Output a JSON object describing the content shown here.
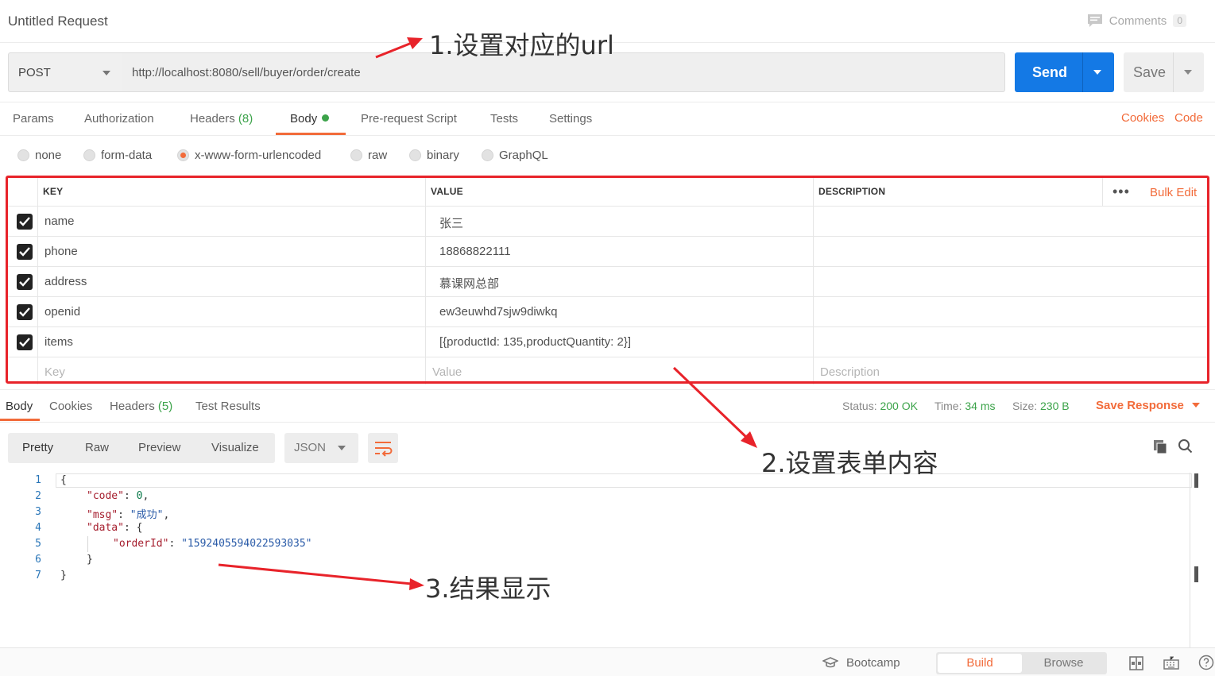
{
  "window": {
    "title": "Untitled Request"
  },
  "comments": {
    "label": "Comments",
    "count": "0"
  },
  "request": {
    "method": "POST",
    "url": "http://localhost:8080/sell/buyer/order/create",
    "send_label": "Send",
    "save_label": "Save"
  },
  "req_tabs": {
    "params": "Params",
    "authorization": "Authorization",
    "headers": "Headers",
    "headers_count": "(8)",
    "body": "Body",
    "prerequest": "Pre-request Script",
    "tests": "Tests",
    "settings": "Settings",
    "cookies": "Cookies",
    "code": "Code"
  },
  "body_types": {
    "none": "none",
    "form_data": "form-data",
    "urlencoded": "x-www-form-urlencoded",
    "raw": "raw",
    "binary": "binary",
    "graphql": "GraphQL",
    "selected": "x-www-form-urlencoded"
  },
  "params_table": {
    "headers": {
      "key": "KEY",
      "value": "VALUE",
      "description": "DESCRIPTION"
    },
    "more": "•••",
    "bulk_edit": "Bulk Edit",
    "rows": [
      {
        "key": "name",
        "value": "张三",
        "description": ""
      },
      {
        "key": "phone",
        "value": "18868822111",
        "description": ""
      },
      {
        "key": "address",
        "value": "慕课网总部",
        "description": ""
      },
      {
        "key": "openid",
        "value": "ew3euwhd7sjw9diwkq",
        "description": ""
      },
      {
        "key": "items",
        "value": "[{productId: 135,productQuantity: 2}]",
        "description": ""
      }
    ],
    "placeholders": {
      "key": "Key",
      "value": "Value",
      "description": "Description"
    }
  },
  "response": {
    "tabs": {
      "body": "Body",
      "cookies": "Cookies",
      "headers": "Headers",
      "headers_count": "(5)",
      "test_results": "Test Results"
    },
    "status_label": "Status:",
    "status_value": "200 OK",
    "time_label": "Time:",
    "time_value": "34 ms",
    "size_label": "Size:",
    "size_value": "230 B",
    "save_response": "Save Response",
    "views": {
      "pretty": "Pretty",
      "raw": "Raw",
      "preview": "Preview",
      "visualize": "Visualize"
    },
    "format": "JSON",
    "code_lines": {
      "l1_no": "1",
      "l2_no": "2",
      "l3_no": "3",
      "l4_no": "4",
      "l5_no": "5",
      "l6_no": "6",
      "l7_no": "7",
      "open_brace": "{",
      "code_key": "\"code\"",
      "code_val": "0",
      "msg_key": "\"msg\"",
      "msg_val": "\"成功\"",
      "data_key": "\"data\"",
      "data_open": "{",
      "orderid_key": "\"orderId\"",
      "orderid_val": "\"1592405594022593035\"",
      "inner_close": "}",
      "close_brace": "}",
      "colon": ": ",
      "comma": ","
    }
  },
  "annotations": {
    "step1": "1.设置对应的url",
    "step2": "2.设置表单内容",
    "step3": "3.结果显示"
  },
  "statusbar": {
    "bootcamp": "Bootcamp",
    "build": "Build",
    "browse": "Browse"
  },
  "colors": {
    "accent": "#f26b3a",
    "send": "#1479e5",
    "annotation_red": "#e8232a",
    "ok_green": "#3ca34a"
  },
  "icons": [
    "comment-icon",
    "chevron-down-icon",
    "checkbox-checked-icon",
    "wrap-lines-icon",
    "copy-icon",
    "search-icon",
    "graduation-cap-icon",
    "two-pane-icon",
    "keyboard-icon",
    "help-icon"
  ]
}
